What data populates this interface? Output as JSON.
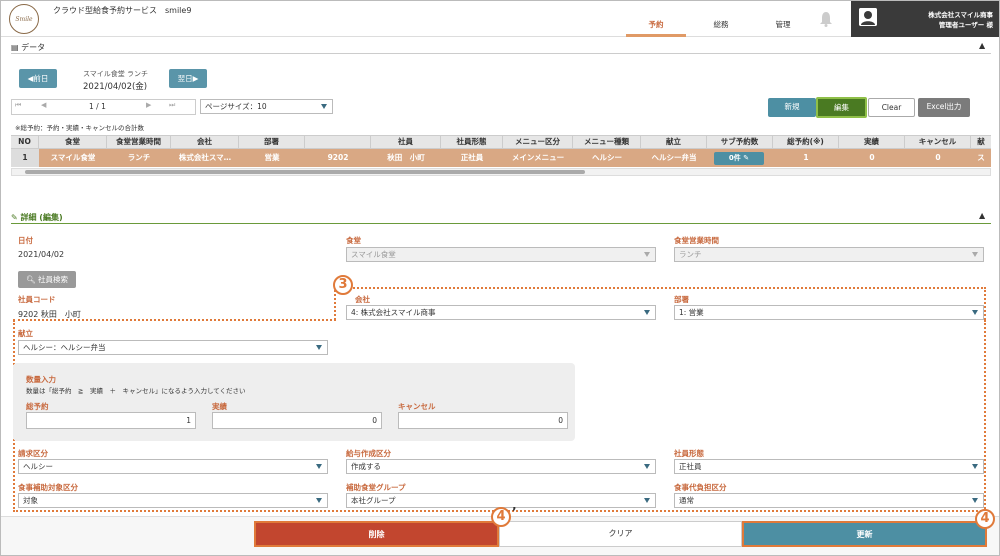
{
  "header": {
    "logo_text": "Smile",
    "app_title": "クラウド型給食予約サービス　smile9",
    "tabs": [
      "予約",
      "総務",
      "管理"
    ],
    "company": "株式会社スマイル商事",
    "user": "管理者ユーザー 様"
  },
  "data_section": {
    "title": "データ",
    "prev_button": "◀前日",
    "next_button": "翌日▶",
    "cafeteria_label": "スマイル食堂 ランチ",
    "date": "2021/04/02(金)",
    "page_indicator": "1 / 1",
    "page_size": "ページサイズ：10",
    "buttons": {
      "new": "新規",
      "edit": "編集",
      "clear": "Clear",
      "excel": "Excel出力"
    },
    "note": "※総予約：予約・実績・キャンセルの合計数"
  },
  "table": {
    "headers": [
      "NO",
      "食堂",
      "食堂営業時間",
      "会社",
      "部署",
      "",
      "社員",
      "社員形態",
      "メニュー区分",
      "メニュー種類",
      "献立",
      "サブ予約数",
      "総予約(※)",
      "実績",
      "キャンセル",
      "献"
    ],
    "row": [
      "1",
      "スマイル食堂",
      "ランチ",
      "株式会社スマ…",
      "営業",
      "9202",
      "秋田　小町",
      "正社員",
      "メインメニュー",
      "ヘルシー",
      "ヘルシー弁当",
      "0件",
      "1",
      "0",
      "0",
      "ス"
    ]
  },
  "detail": {
    "title": "詳細 (編集)",
    "date_label": "日付",
    "date_value": "2021/04/02",
    "cafeteria_label": "食堂",
    "cafeteria_value": "スマイル食堂",
    "hours_label": "食堂営業時間",
    "hours_value": "ランチ",
    "search_button": "社員検索",
    "employee_code_label": "社員コード",
    "employee_code_value": "9202  秋田　小町",
    "company_label": "会社",
    "company_value": "4: 株式会社スマイル商事",
    "dept_label": "部署",
    "dept_value": "1: 営業",
    "menu_label": "献立",
    "menu_value": "ヘルシー：ヘルシー弁当",
    "qty_title": "数量入力",
    "qty_note": "数量は「総予約　≧　実績　＋　キャンセル」になるよう入力してください",
    "total_label": "総予約",
    "total_value": "1",
    "actual_label": "実績",
    "actual_value": "0",
    "cancel_label": "キャンセル",
    "cancel_value": "0",
    "billing_label": "請求区分",
    "billing_value": "ヘルシー",
    "salary_label": "給与作成区分",
    "salary_value": "作成する",
    "emptype_label": "社員形態",
    "emptype_value": "正社員",
    "subsidy_label": "食事補助対象区分",
    "subsidy_value": "対象",
    "group_label": "補助食堂グループ",
    "group_value": "本社グループ",
    "burden_label": "食事代負担区分",
    "burden_value": "通常"
  },
  "footer": {
    "delete": "削除",
    "clear": "クリア",
    "update": "更新"
  },
  "annotations": {
    "c3": "3",
    "c4a": "4",
    "c4a_suffix": "’",
    "c4b": "4"
  },
  "colors": {
    "accent": "#c8693e",
    "teal": "#4d8fa3",
    "delete": "#c2462f",
    "row": "#d9a884",
    "green": "#4a7a22"
  }
}
